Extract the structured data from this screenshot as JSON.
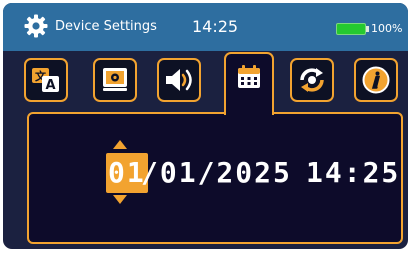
{
  "status_bar": {
    "title": "Device Settings",
    "time": "14:25",
    "battery_level": 100,
    "battery_label": "100%",
    "icons": {
      "settings": "gear-icon",
      "battery": "battery-icon"
    }
  },
  "tabs": [
    {
      "name": "language",
      "icon": "translate-icon",
      "active": false
    },
    {
      "name": "display",
      "icon": "display-settings-icon",
      "active": false
    },
    {
      "name": "sound",
      "icon": "speaker-icon",
      "active": false
    },
    {
      "name": "date-time",
      "icon": "calendar-icon",
      "active": true
    },
    {
      "name": "sync",
      "icon": "sync-icon",
      "active": false
    },
    {
      "name": "info",
      "icon": "info-icon",
      "active": false
    }
  ],
  "datetime": {
    "day": "01",
    "date_rest": "/01/2025",
    "time": "14:25",
    "selected_field": "day"
  },
  "colors": {
    "status_bar": "#2e6ea0",
    "background": "#1b2140",
    "panel": "#0d0b2a",
    "accent": "#f2a330",
    "battery": "#25c92f",
    "text": "#ffffff"
  }
}
